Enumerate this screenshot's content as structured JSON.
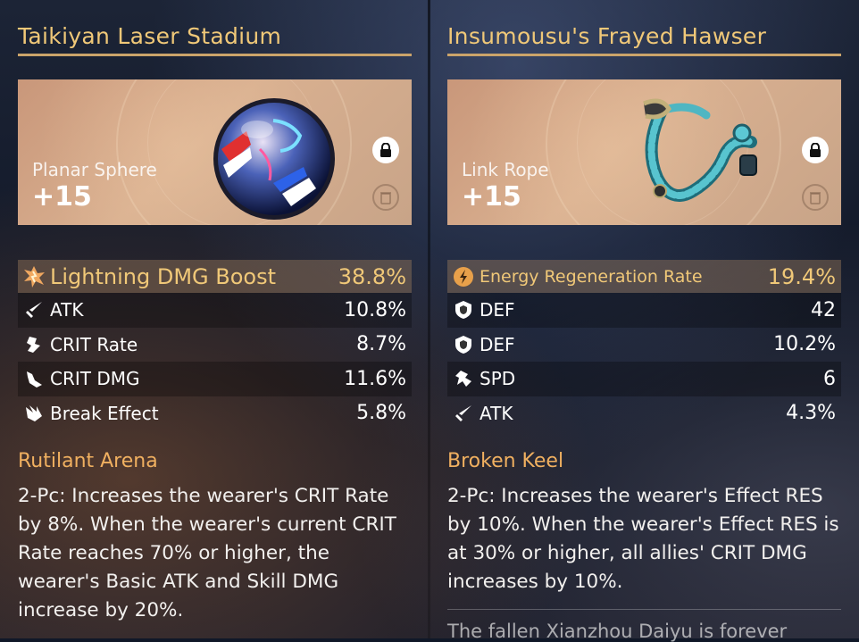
{
  "relics": [
    {
      "title": "Taikiyan Laser Stadium",
      "slot": "Planar Sphere",
      "level": "+15",
      "main_stat": {
        "name": "Lightning DMG Boost",
        "value": "38.8%",
        "icon": "lightning-icon"
      },
      "sub_stats": [
        {
          "name": "ATK",
          "value": "10.8%",
          "icon": "sword-icon"
        },
        {
          "name": "CRIT Rate",
          "value": "8.7%",
          "icon": "crit-rate-icon"
        },
        {
          "name": "CRIT DMG",
          "value": "11.6%",
          "icon": "crit-dmg-icon"
        },
        {
          "name": "Break Effect",
          "value": "5.8%",
          "icon": "break-icon"
        }
      ],
      "set_name": "Rutilant Arena",
      "set_desc": "2-Pc: Increases the wearer's CRIT Rate by 8%. When the wearer's current CRIT Rate reaches 70% or higher, the wearer's Basic ATK and Skill DMG increase by 20%."
    },
    {
      "title": "Insumousu's Frayed Hawser",
      "slot": "Link Rope",
      "level": "+15",
      "main_stat": {
        "name": "Energy Regeneration Rate",
        "value": "19.4%",
        "icon": "energy-icon"
      },
      "sub_stats": [
        {
          "name": "DEF",
          "value": "42",
          "icon": "shield-icon"
        },
        {
          "name": "DEF",
          "value": "10.2%",
          "icon": "shield-icon"
        },
        {
          "name": "SPD",
          "value": "6",
          "icon": "speed-icon"
        },
        {
          "name": "ATK",
          "value": "4.3%",
          "icon": "sword-icon"
        }
      ],
      "set_name": "Broken Keel",
      "set_desc": "2-Pc: Increases the wearer's Effect RES by 10%. When the wearer's Effect RES is at 30% or higher, all allies' CRIT DMG increases by 10%.",
      "lore": "The fallen Xianzhou Daiyu is forever"
    }
  ],
  "colors": {
    "gold": "#f0c878",
    "orange": "#f0b060",
    "card": "#d9b090"
  }
}
